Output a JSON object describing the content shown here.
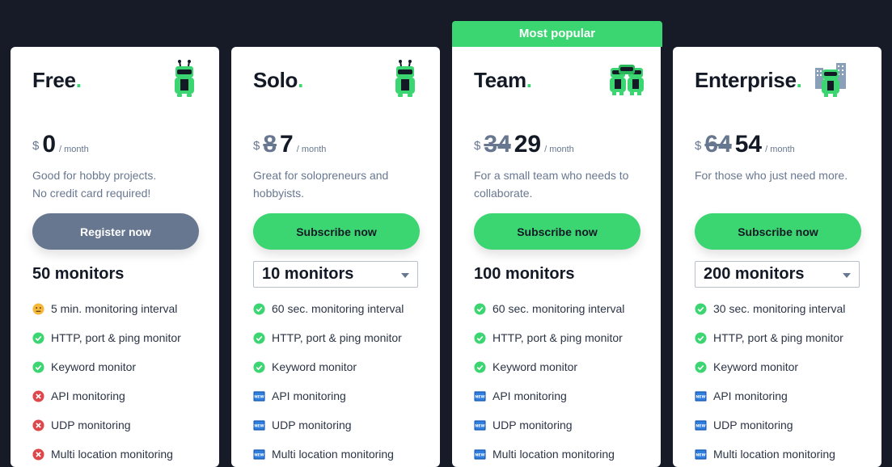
{
  "popular_label": "Most popular",
  "colors": {
    "accent": "#3bd671",
    "background": "#161b27",
    "muted": "#687790"
  },
  "plans": [
    {
      "name": "Free",
      "mascot": "robot-icon",
      "currency": "$",
      "old_price": "",
      "price": "0",
      "period": "/ month",
      "description": "Good for hobby projects.\nNo credit card required!",
      "button_label": "Register now",
      "monitors": "50 monitors",
      "features": [
        {
          "icon": "neutral-face-icon",
          "text": "5 min. monitoring interval"
        },
        {
          "icon": "check-icon",
          "text": "HTTP, port & ping monitor"
        },
        {
          "icon": "check-icon",
          "text": "Keyword monitor"
        },
        {
          "icon": "cross-icon",
          "text": "API monitoring"
        },
        {
          "icon": "cross-icon",
          "text": "UDP monitoring"
        },
        {
          "icon": "cross-icon",
          "text": "Multi location monitoring"
        }
      ]
    },
    {
      "name": "Solo",
      "mascot": "robot-icon",
      "currency": "$",
      "old_price": "8",
      "price": "7",
      "period": "/ month",
      "description": "Great for solopreneurs and hobbyists.",
      "button_label": "Subscribe now",
      "monitors": "10 monitors",
      "features": [
        {
          "icon": "check-icon",
          "text": "60 sec. monitoring interval"
        },
        {
          "icon": "check-icon",
          "text": "HTTP, port & ping monitor"
        },
        {
          "icon": "check-icon",
          "text": "Keyword monitor"
        },
        {
          "icon": "new-badge-icon",
          "text": "API monitoring"
        },
        {
          "icon": "new-badge-icon",
          "text": "UDP monitoring"
        },
        {
          "icon": "new-badge-icon",
          "text": "Multi location monitoring"
        }
      ]
    },
    {
      "name": "Team",
      "mascot": "robot-team-icon",
      "currency": "$",
      "old_price": "34",
      "price": "29",
      "period": "/ month",
      "description": "For a small team who needs to collaborate.",
      "button_label": "Subscribe now",
      "monitors": "100 monitors",
      "features": [
        {
          "icon": "check-icon",
          "text": "60 sec. monitoring interval"
        },
        {
          "icon": "check-icon",
          "text": "HTTP, port & ping monitor"
        },
        {
          "icon": "check-icon",
          "text": "Keyword monitor"
        },
        {
          "icon": "new-badge-icon",
          "text": "API monitoring"
        },
        {
          "icon": "new-badge-icon",
          "text": "UDP monitoring"
        },
        {
          "icon": "new-badge-icon",
          "text": "Multi location monitoring"
        }
      ]
    },
    {
      "name": "Enterprise",
      "mascot": "robot-enterprise-icon",
      "currency": "$",
      "old_price": "64",
      "price": "54",
      "period": "/ month",
      "description": "For those who just need more.",
      "button_label": "Subscribe now",
      "monitors": "200 monitors",
      "features": [
        {
          "icon": "check-icon",
          "text": "30 sec. monitoring interval"
        },
        {
          "icon": "check-icon",
          "text": "HTTP, port & ping monitor"
        },
        {
          "icon": "check-icon",
          "text": "Keyword monitor"
        },
        {
          "icon": "new-badge-icon",
          "text": "API monitoring"
        },
        {
          "icon": "new-badge-icon",
          "text": "UDP monitoring"
        },
        {
          "icon": "new-badge-icon",
          "text": "Multi location monitoring"
        }
      ]
    }
  ]
}
